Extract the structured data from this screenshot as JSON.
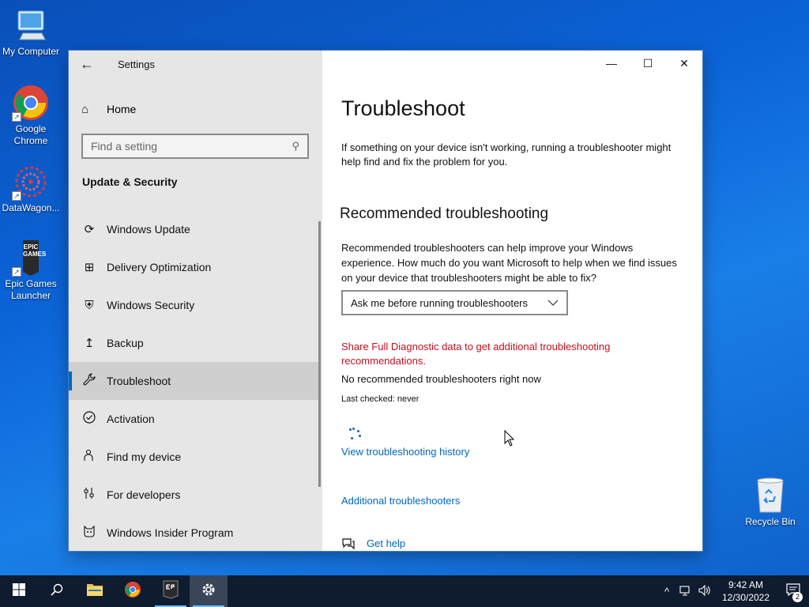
{
  "desktop": {
    "icons": [
      {
        "label": "My Computer"
      },
      {
        "label": "Google Chrome"
      },
      {
        "label": "DataWagon..."
      },
      {
        "label": "Epic Games Launcher"
      }
    ],
    "recycle_bin": "Recycle Bin",
    "epic_logo_text": "EPIC GAMES"
  },
  "window": {
    "title": "Settings",
    "home_label": "Home",
    "search_placeholder": "Find a setting",
    "section_title": "Update & Security",
    "nav": [
      {
        "label": "Windows Update",
        "icon": "refresh-icon",
        "glyph": "⟳"
      },
      {
        "label": "Delivery Optimization",
        "icon": "delivery-icon",
        "glyph": "⊞"
      },
      {
        "label": "Windows Security",
        "icon": "shield-icon",
        "glyph": "⛨"
      },
      {
        "label": "Backup",
        "icon": "backup-icon",
        "glyph": "↥"
      },
      {
        "label": "Troubleshoot",
        "icon": "wrench-icon",
        "glyph": "🔧",
        "active": true
      },
      {
        "label": "Activation",
        "icon": "check-circle-icon",
        "glyph": "✓"
      },
      {
        "label": "Find my device",
        "icon": "person-location-icon",
        "glyph": "⚲"
      },
      {
        "label": "For developers",
        "icon": "sliders-icon",
        "glyph": "⫴"
      },
      {
        "label": "Windows Insider Program",
        "icon": "insider-cat-icon",
        "glyph": "☺"
      }
    ]
  },
  "main": {
    "title": "Troubleshoot",
    "intro": "If something on your device isn't working, running a troubleshooter might help find and fix the problem for you.",
    "rec_heading": "Recommended troubleshooting",
    "rec_desc": "Recommended troubleshooters can help improve your Windows experience. How much do you want Microsoft to help when we find issues on your device that troubleshooters might be able to fix?",
    "dropdown_value": "Ask me before running troubleshooters",
    "warning_link": "Share Full Diagnostic data to get additional troubleshooting recommendations.",
    "none_now": "No recommended troubleshooters right now",
    "last_checked": "Last checked: never",
    "history_link": "View troubleshooting history",
    "additional_link": "Additional troubleshooters",
    "help_link": "Get help"
  },
  "taskbar": {
    "apps": [
      "start-icon",
      "search-icon",
      "file-explorer-icon",
      "chrome-icon",
      "epic-games-icon",
      "settings-icon"
    ],
    "time": "9:42 AM",
    "date": "12/30/2022",
    "notification_count": "2"
  },
  "colors": {
    "accent": "#0067c0",
    "warning": "#c50f1f",
    "sidebar_bg": "#e6e6e6",
    "taskbar_bg": "#0f1b2e"
  }
}
